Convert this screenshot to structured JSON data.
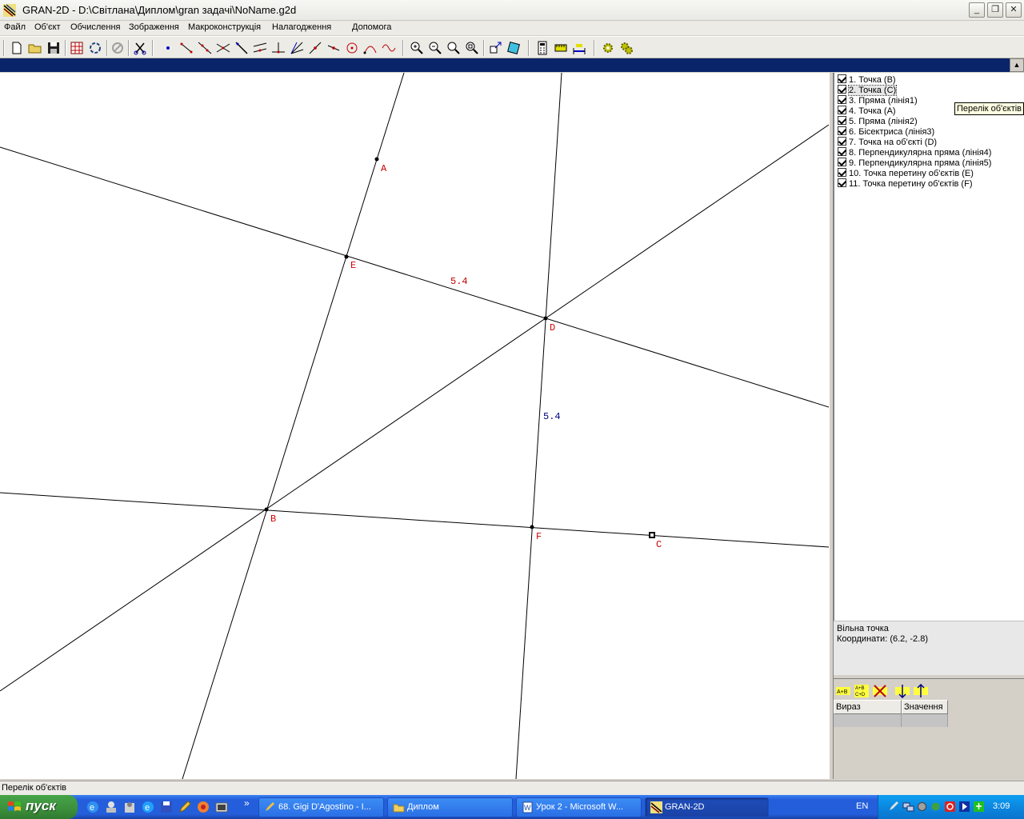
{
  "window": {
    "title": "GRAN-2D - D:\\Світлана\\Диплом\\gran задачі\\NoName.g2d",
    "min_label": "_",
    "max_label": "❐",
    "close_label": "✕"
  },
  "menu": [
    "Файл",
    "Об'єкт",
    "Обчислення",
    "Зображення",
    "Макроконструкція",
    "Налагодження",
    "Допомога"
  ],
  "canvas": {
    "points": [
      {
        "label": "A"
      },
      {
        "label": "E"
      },
      {
        "label": "D"
      },
      {
        "label": "B"
      },
      {
        "label": "F"
      },
      {
        "label": "C"
      }
    ],
    "length_labels": [
      "5.4",
      "5.4"
    ],
    "colors": {
      "point_label": "#d00000",
      "line": "#000000",
      "length_label": "#000080"
    }
  },
  "objects": [
    "1. Точка (B)",
    "2. Точка (C)",
    "3. Пряма (лінія1)",
    "4. Точка (A)",
    "5. Пряма (лінія2)",
    "6. Бісектриса (лінія3)",
    "7. Точка на об'єкті (D)",
    "8. Перпендикулярна пряма (лінія4)",
    "9. Перпендикулярна пряма (лінія5)",
    "10. Точка перетину об'єктів (E)",
    "11. Точка перетину об'єктів (F)"
  ],
  "selected_object_index": 1,
  "tooltip": "Перелік об'єктів",
  "info": {
    "type": "Вільна точка",
    "coords": "Координати: (6.2, -2.8)"
  },
  "calc": {
    "col_expression": "Вираз",
    "col_value": "Значення"
  },
  "status": "Перелік об'єктів",
  "taskbar": {
    "start": "пуск",
    "more_label": "»",
    "tasks": [
      {
        "label": "68. Gigi D'Agostino - I..."
      },
      {
        "label": "Диплом"
      },
      {
        "label": "Урок 2 - Microsoft W..."
      },
      {
        "label": "GRAN-2D"
      }
    ],
    "lang": "EN",
    "clock": "3:09"
  }
}
